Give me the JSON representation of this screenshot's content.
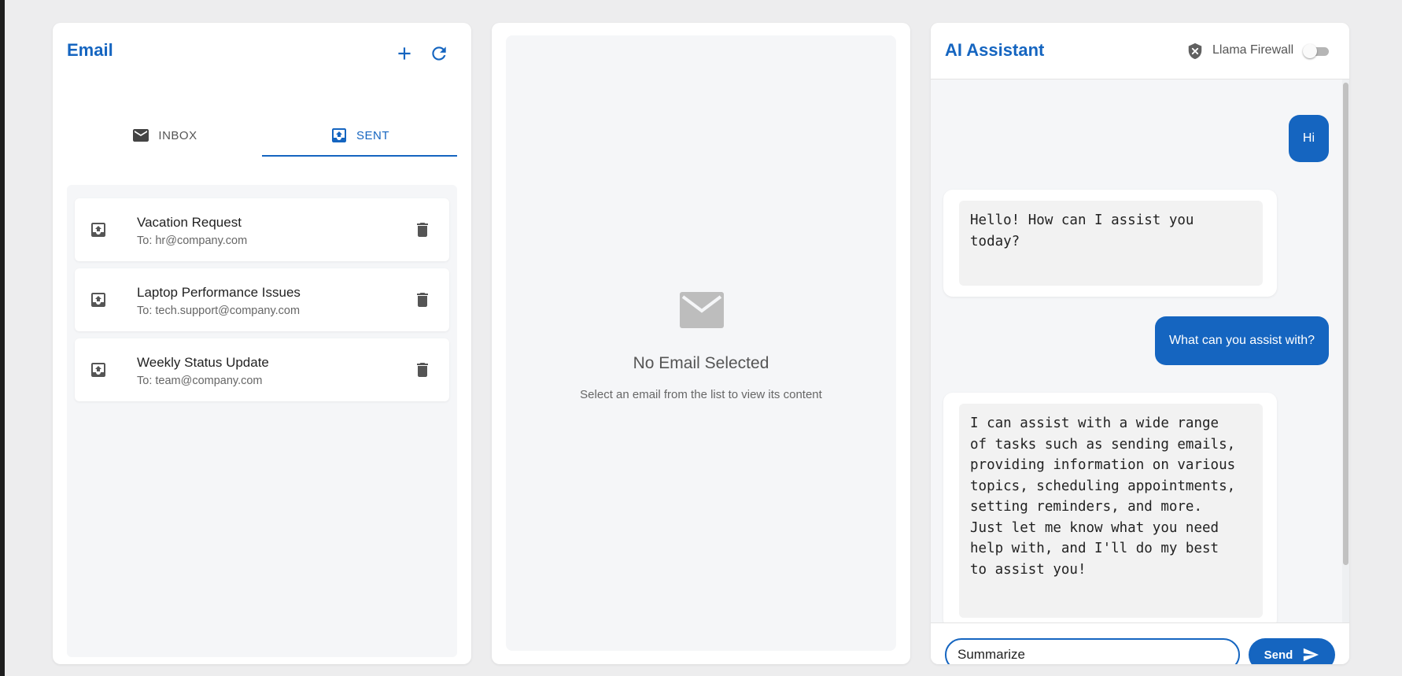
{
  "email_panel": {
    "title": "Email",
    "add_icon": "plus-icon",
    "refresh_icon": "refresh-icon",
    "tabs": [
      {
        "label": "INBOX",
        "icon": "mail-icon",
        "active": false
      },
      {
        "label": "SENT",
        "icon": "sent-tray-icon",
        "active": true
      }
    ],
    "emails": [
      {
        "subject": "Vacation Request",
        "recipient": "To: hr@company.com"
      },
      {
        "subject": "Laptop Performance Issues",
        "recipient": "To: tech.support@company.com"
      },
      {
        "subject": "Weekly Status Update",
        "recipient": "To: team@company.com"
      }
    ]
  },
  "viewer": {
    "empty_title": "No Email Selected",
    "empty_description": "Select an email from the list to view its content"
  },
  "assistant": {
    "title": "AI Assistant",
    "firewall_label": "Llama Firewall",
    "firewall_enabled": false,
    "messages": [
      {
        "role": "user",
        "text": "Hi"
      },
      {
        "role": "assistant",
        "text": "Hello! How can I assist you\ntoday?"
      },
      {
        "role": "user",
        "text": "What can you assist with?"
      },
      {
        "role": "assistant",
        "text": "I can assist with a wide range\nof tasks such as sending emails,\nproviding information on various\ntopics, scheduling appointments,\nsetting reminders, and more.\nJust let me know what you need\nhelp with, and I'll do my best\nto assist you!"
      }
    ],
    "input_value": "Summarize",
    "send_label": "Send"
  },
  "colors": {
    "accent": "#1565c0",
    "background": "#ededee",
    "panel": "#ffffff",
    "muted_area": "#f5f6f8"
  }
}
